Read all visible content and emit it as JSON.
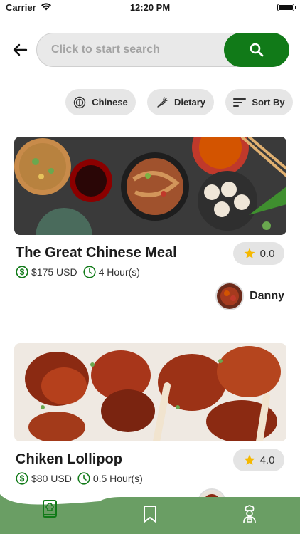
{
  "status_bar": {
    "carrier": "Carrier",
    "time": "12:20 PM"
  },
  "search": {
    "placeholder": "Click to start search"
  },
  "filters": [
    {
      "label": "Chinese",
      "icon": "cuisine-icon"
    },
    {
      "label": "Dietary",
      "icon": "carrot-icon"
    },
    {
      "label": "Sort By",
      "icon": "sort-icon"
    }
  ],
  "recipes": [
    {
      "title": "The Great Chinese Meal",
      "rating": "0.0",
      "price": "$175 USD",
      "duration": "4 Hour(s)",
      "author": "Danny"
    },
    {
      "title": "Chiken Lollipop",
      "rating": "4.0",
      "price": "$80 USD",
      "duration": "0.5 Hour(s)"
    }
  ],
  "colors": {
    "accent": "#117a18",
    "nav_bg": "#6a9e64",
    "star": "#f5b800"
  },
  "bottom_nav": [
    {
      "name": "recipe-book",
      "icon": "recipe-book-icon",
      "active": true
    },
    {
      "name": "saved",
      "icon": "bookmark-icon"
    },
    {
      "name": "profile",
      "icon": "chef-icon"
    }
  ]
}
